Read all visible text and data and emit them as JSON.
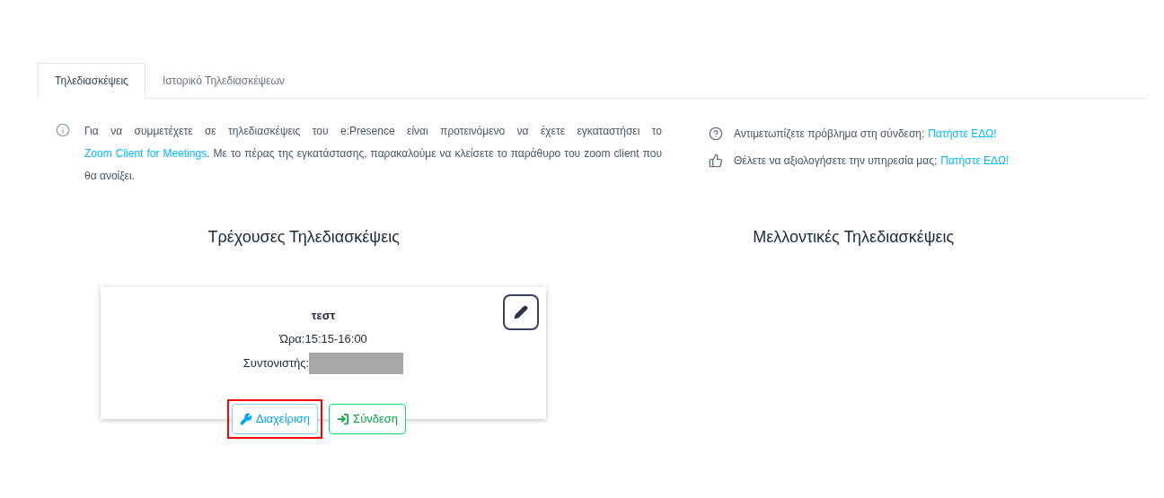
{
  "tabs": [
    {
      "label": "Τηλεδιασκέψεις",
      "selected": true
    },
    {
      "label": "Ιστορικό Τηλεδιασκέψεων",
      "selected": false
    }
  ],
  "info": {
    "before": "Για να συμμετέχετε σε τηλεδιασκέψεις του e:Presence είναι προτεινόμενο να έχετε εγκαταστήσει το",
    "link": "Zoom Client for Meetings",
    "after": ". Με το πέρας της εγκατάστασης, παρακαλούμε να κλείσετε το παράθυρο του zoom client που θα ανοίξει."
  },
  "help": [
    {
      "kind": "question",
      "text": "Αντιμετωπίζετε πρόβλημα στη σύνδεση;",
      "link": "Πατήστε ΕΔΩ!"
    },
    {
      "kind": "thumb",
      "text": "Θέλετε να αξιολογήσετε την υπηρεσία μας;",
      "link": "Πατήστε ΕΔΩ!"
    }
  ],
  "current": {
    "heading": "Τρέχουσες Τηλεδιασκέψεις",
    "meetings": [
      {
        "title": "τεστ",
        "time": "Ώρα:15:15-16:00",
        "host_label": "Συντονιστής:",
        "host_redacted": true,
        "buttons": [
          {
            "kind": "manage",
            "label": "Διαχείριση",
            "highlighted": true
          },
          {
            "kind": "join",
            "label": "Σύνδεση",
            "highlighted": false
          }
        ]
      }
    ]
  },
  "upcoming": {
    "heading": "Μελλοντικές Τηλεδιασκέψεις"
  }
}
